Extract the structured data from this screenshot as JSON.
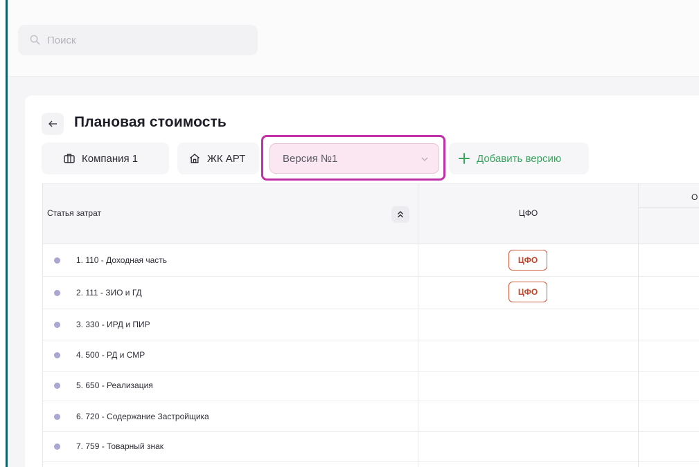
{
  "search": {
    "placeholder": "Поиск"
  },
  "page": {
    "title": "Плановая стоимость"
  },
  "filters": {
    "company_label": "Компания 1",
    "project_label": "ЖК АРТ",
    "version_value": "Версия №1",
    "add_version_label": "Добавить версию"
  },
  "table": {
    "columns": {
      "article": "Статья затрат",
      "cfo": "ЦФО",
      "next_partial": "О"
    },
    "rows": [
      {
        "label": "1. 110 - Доходная часть",
        "cfo_tag": "ЦФО"
      },
      {
        "label": "2. 111 - ЗИО и ГД",
        "cfo_tag": "ЦФО"
      },
      {
        "label": "3. 330 - ИРД и ПИР"
      },
      {
        "label": "4. 500 - РД и СМР"
      },
      {
        "label": "5. 650 - Реализация"
      },
      {
        "label": "6. 720 - Содержание Застройщика"
      },
      {
        "label": "7. 759 - Товарный знак"
      }
    ]
  },
  "colors": {
    "accent_green": "#3aa55e",
    "highlight_magenta": "#c230a8",
    "cfo_tag_red": "#c2452a",
    "row_dot": "#a9a7d2",
    "left_rule": "#0f5f6a"
  },
  "icons": {
    "search": "search-icon",
    "back": "arrow-left-icon",
    "company": "briefcase-icon",
    "project": "house-icon",
    "dropdown": "chevron-down-icon",
    "add": "plus-icon",
    "sort": "double-chevron-up-icon",
    "row_marker": "dot-icon"
  }
}
